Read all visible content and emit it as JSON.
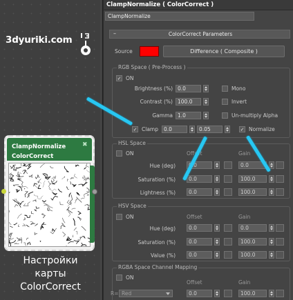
{
  "view": {
    "watermark": "3dyuriki.com",
    "node": {
      "title_line1": "ClampNormalize",
      "title_line2": "ColorCorrect",
      "pin_icon": "pin-icon"
    },
    "caption_lines": [
      "Настройки",
      "карты",
      "ColorCorrect"
    ]
  },
  "panel": {
    "title": "ClampNormalize ( ColorCorrect )",
    "name_field": "ClampNormalize",
    "rollout": {
      "collapse_symbol": "–",
      "title": "ColorCorrect Parameters"
    },
    "source": {
      "label": "Source",
      "swatch_color": "#ff0000",
      "mode": "Difference ( Composite )"
    },
    "rgb_space": {
      "title": "RGB Space ( Pre-Process )",
      "on_label": "ON",
      "on_checked": true,
      "brightness": {
        "label": "Brightness (%)",
        "value": "0.0"
      },
      "contrast": {
        "label": "Contrast (%)",
        "value": "100.0"
      },
      "gamma": {
        "label": "Gamma",
        "value": "1.0"
      },
      "mono": {
        "label": "Mono",
        "checked": false
      },
      "invert": {
        "label": "Invert",
        "checked": false
      },
      "unmultiply": {
        "label": "Un-multiply Alpha",
        "checked": false
      },
      "clamp": {
        "label": "Clamp",
        "checked": true,
        "min": "0.0",
        "max": "0.05"
      },
      "normalize": {
        "label": "Normalize",
        "checked": true
      }
    },
    "hsl_space": {
      "title": "HSL Space",
      "on_label": "ON",
      "on_checked": false,
      "offset_header": "Offset",
      "gain_header": "Gain",
      "rows": [
        {
          "label": "Hue (deg)",
          "offset": "0.0",
          "gain": "0.0"
        },
        {
          "label": "Saturation (%)",
          "offset": "0.0",
          "gain": "100.0"
        },
        {
          "label": "Lightness (%)",
          "offset": "0.0",
          "gain": "100.0"
        }
      ]
    },
    "hsv_space": {
      "title": "HSV Space",
      "on_label": "ON",
      "on_checked": false,
      "offset_header": "Offset",
      "gain_header": "Gain",
      "rows": [
        {
          "label": "Hue (deg)",
          "offset": "0.0",
          "gain": "0.0"
        },
        {
          "label": "Saturation (%)",
          "offset": "0.0",
          "gain": "100.0"
        },
        {
          "label": "Value (%)",
          "offset": "0.0",
          "gain": "100.0"
        }
      ]
    },
    "rgba_mapping": {
      "title": "RGBA Space Channel Mapping",
      "on_label": "ON",
      "on_checked": false,
      "offset_header": "Offset",
      "gain_header": "Gain",
      "row_label": "R=",
      "channel": "Red",
      "offset": "0.0",
      "gain": "100.0"
    },
    "annotation_color": "#27c7f2"
  }
}
